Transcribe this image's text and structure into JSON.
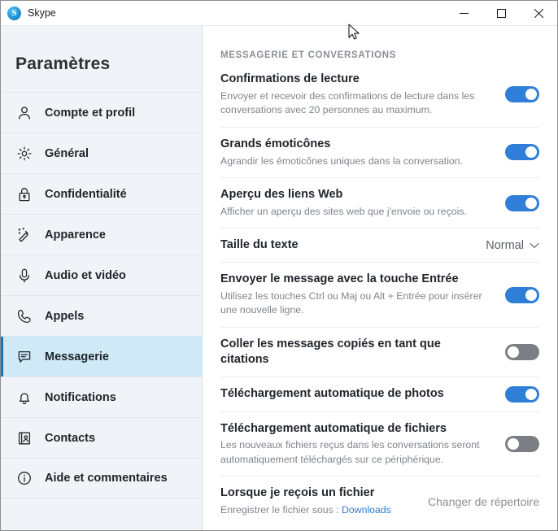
{
  "titlebar": {
    "app_name": "Skype",
    "logo_letter": "S",
    "minimize_label": "Minimiser",
    "maximize_label": "Agrandir",
    "close_label": "Fermer"
  },
  "sidebar": {
    "title": "Paramètres",
    "items": [
      {
        "label": "Compte et profil",
        "icon": "person-icon",
        "active": false
      },
      {
        "label": "Général",
        "icon": "gear-icon",
        "active": false
      },
      {
        "label": "Confidentialité",
        "icon": "lock-icon",
        "active": false
      },
      {
        "label": "Apparence",
        "icon": "magic-wand-icon",
        "active": false
      },
      {
        "label": "Audio et vidéo",
        "icon": "microphone-icon",
        "active": false
      },
      {
        "label": "Appels",
        "icon": "phone-icon",
        "active": false
      },
      {
        "label": "Messagerie",
        "icon": "chat-bubble-icon",
        "active": true
      },
      {
        "label": "Notifications",
        "icon": "bell-icon",
        "active": false
      },
      {
        "label": "Contacts",
        "icon": "address-book-icon",
        "active": false
      },
      {
        "label": "Aide et commentaires",
        "icon": "info-icon",
        "active": false
      }
    ]
  },
  "content": {
    "section_header": "MESSAGERIE ET CONVERSATIONS",
    "rows": [
      {
        "title": "Confirmations de lecture",
        "desc": "Envoyer et recevoir des confirmations de lecture dans les conversations avec 20 personnes au maximum.",
        "control": "toggle",
        "state": "on"
      },
      {
        "title": "Grands émoticônes",
        "desc": "Agrandir les émoticônes uniques dans la conversation.",
        "control": "toggle",
        "state": "on"
      },
      {
        "title": "Aperçu des liens Web",
        "desc": "Afficher un aperçu des sites web que j'envoie ou reçois.",
        "control": "toggle",
        "state": "on"
      },
      {
        "title": "Taille du texte",
        "desc": "",
        "control": "dropdown",
        "value": "Normal"
      },
      {
        "title": "Envoyer le message avec la touche Entrée",
        "desc": "Utilisez les touches Ctrl ou Maj ou Alt + Entrée pour insérer une nouvelle ligne.",
        "control": "toggle",
        "state": "on"
      },
      {
        "title": "Coller les messages copiés en tant que citations",
        "desc": "",
        "control": "toggle",
        "state": "off"
      },
      {
        "title": "Téléchargement automatique de photos",
        "desc": "",
        "control": "toggle",
        "state": "on"
      },
      {
        "title": "Téléchargement automatique de fichiers",
        "desc": "Les nouveaux fichiers reçus dans les conversations seront automatiquement téléchargés sur ce périphérique.",
        "control": "toggle",
        "state": "off"
      }
    ],
    "file_row": {
      "title": "Lorsque je reçois un fichier",
      "desc_prefix": "Enregistrer le fichier sous :",
      "folder_link": "Downloads",
      "button_label": "Changer de répertoire"
    }
  },
  "colors": {
    "toggle_on": "#2f7ed8",
    "toggle_off": "#7b7f85",
    "active_nav_bg": "#cfe9f7",
    "active_nav_accent": "#1b74b8",
    "link": "#2b7cd3",
    "sidebar_bg": "#f0f3f7"
  }
}
